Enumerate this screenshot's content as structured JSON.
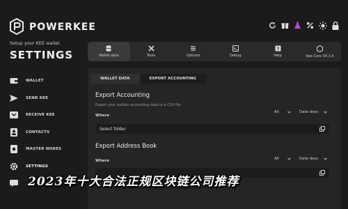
{
  "brand": {
    "name": "POWERKEE"
  },
  "sidebar": {
    "subtitle": "Setup your KEE wallet",
    "title": "SETTINGS",
    "items": [
      {
        "label": "WALLET",
        "icon": "wallet-icon"
      },
      {
        "label": "SEND KEE",
        "icon": "send-icon"
      },
      {
        "label": "RECEIVE KEE",
        "icon": "receive-icon"
      },
      {
        "label": "CONTACTS",
        "icon": "contacts-icon"
      },
      {
        "label": "MASTER NODES",
        "icon": "nodes-icon"
      },
      {
        "label": "SETTINGS",
        "icon": "gear-icon"
      },
      {
        "label": "",
        "icon": "message-icon"
      }
    ]
  },
  "topbar": {
    "icons": [
      "refresh-icon",
      "gift-icon",
      "flask-icon",
      "percent-icon",
      "brightness-icon",
      "lock-icon"
    ]
  },
  "tabs": [
    {
      "label": "Wallet data",
      "icon": "database-icon"
    },
    {
      "label": "Tools",
      "icon": "tools-icon"
    },
    {
      "label": "Options",
      "icon": "options-icon"
    },
    {
      "label": "Debug",
      "icon": "debug-icon"
    },
    {
      "label": "Help",
      "icon": "help-icon"
    },
    {
      "label": "Kee Core V4.3.4",
      "icon": "core-icon"
    }
  ],
  "subtabs": [
    {
      "label": "WALLET DATA"
    },
    {
      "label": "EXPORT ACCOUNTING"
    }
  ],
  "export_accounting": {
    "title": "Export Accounting",
    "description": "Export your wallets accounting data to a CSV file.",
    "where_label": "Where",
    "filter_value": "All",
    "sort_value": "Date desc",
    "folder_value": "Select folder"
  },
  "export_address_book": {
    "title": "Export Address Book",
    "where_label": "Where",
    "filter_value": "All",
    "sort_value": "Date desc"
  },
  "overlay_text": "2023年十大合法正规区块链公司推荐",
  "colors": {
    "background": "#1b1b1b",
    "panel": "#252525",
    "tab_bar": "#2a2a2a",
    "accent_flask": "#b04dd8"
  }
}
